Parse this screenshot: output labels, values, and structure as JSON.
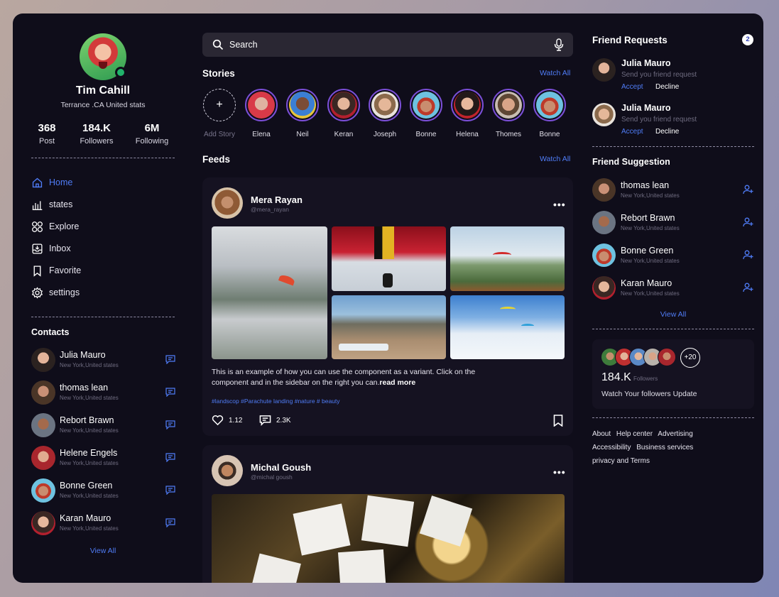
{
  "profile": {
    "name": "Tim Cahill",
    "location": "Terrance .CA United stats",
    "stats": [
      {
        "value": "368",
        "label": "Post"
      },
      {
        "value": "184.K",
        "label": "Followers"
      },
      {
        "value": "6M",
        "label": "Following"
      }
    ]
  },
  "nav": {
    "items": [
      {
        "label": "Home",
        "icon": "home-icon",
        "active": true
      },
      {
        "label": "states",
        "icon": "bar-chart-icon"
      },
      {
        "label": "Explore",
        "icon": "grid-icon"
      },
      {
        "label": "Inbox",
        "icon": "inbox-icon"
      },
      {
        "label": "Favorite",
        "icon": "bookmark-icon"
      },
      {
        "label": "settings",
        "icon": "gear-icon"
      }
    ]
  },
  "contacts": {
    "title": "Contacts",
    "items": [
      {
        "name": "Julia Mauro",
        "location": "New York,United states"
      },
      {
        "name": "thomas lean",
        "location": "New York,United states"
      },
      {
        "name": "Rebort Brawn",
        "location": "New York,United states"
      },
      {
        "name": "Helene Engels",
        "location": "New York,United states"
      },
      {
        "name": "Bonne Green",
        "location": "New York,United states"
      },
      {
        "name": "Karan Mauro",
        "location": "New York,United states"
      }
    ],
    "view_all": "View All"
  },
  "search": {
    "placeholder": "Search"
  },
  "stories": {
    "title": "Stories",
    "watch_all": "Watch All",
    "add_label": "Add Story",
    "items": [
      "Elena",
      "Neil",
      "Keran",
      "Joseph",
      "Bonne",
      "Helena",
      "Thomes",
      "Bonne"
    ]
  },
  "feeds": {
    "title": "Feeds",
    "watch_all": "Watch All",
    "posts": [
      {
        "author": "Mera Rayan",
        "handle": "@mera_rayan",
        "caption": "This is an example of how you can use the component as a variant. Click on the component and in the sidebar on the right you can.",
        "read_more": "read more",
        "tags": "#landscop #Parachute landing #nature # beauty",
        "likes": "1.12",
        "comments": "2.3K"
      },
      {
        "author": "Michal Goush",
        "handle": "@michal goush"
      }
    ]
  },
  "friend_requests": {
    "title": "Friend Requests",
    "count": "2",
    "items": [
      {
        "name": "Julia Mauro",
        "message": "Send you friend request",
        "accept": "Accept",
        "decline": "Decline"
      },
      {
        "name": "Julia Mauro",
        "message": "Send you friend request",
        "accept": "Accept",
        "decline": "Decline"
      }
    ]
  },
  "suggestions": {
    "title": "Friend Suggestion",
    "items": [
      {
        "name": "thomas lean",
        "location": "New York,United states"
      },
      {
        "name": "Rebort Brawn",
        "location": "New York,United states"
      },
      {
        "name": "Bonne Green",
        "location": "New York,United states"
      },
      {
        "name": "Karan Mauro",
        "location": "New York,United states"
      }
    ],
    "view_all": "View All"
  },
  "followers_card": {
    "extra": "+20",
    "count": "184.K",
    "count_label": "Followers",
    "update_text": "Watch Your followers Update"
  },
  "footer": {
    "links": [
      "About",
      "Help center",
      "Advertising",
      "Accessibility",
      "Business services",
      "privacy and Terms"
    ]
  },
  "colors": {
    "background": "#0f0d1a",
    "card": "#151221",
    "accent": "#4f7cf6",
    "online": "#21b36b"
  }
}
